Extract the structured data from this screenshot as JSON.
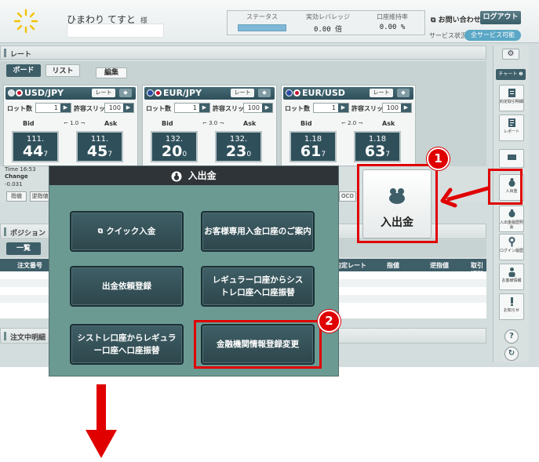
{
  "header": {
    "user_name": "ひまわり てすと",
    "user_suffix": "様",
    "status_label": "ステータス",
    "leverage_label": "実効レバレッジ",
    "leverage_value": "0.00 倍",
    "margin_label": "口座維持率",
    "margin_value": "0.00 %",
    "contact_label": "お問い合わせ",
    "logout_label": "ログアウト",
    "service_label": "サービス状況",
    "service_value": "全サービス可能"
  },
  "rate": {
    "title": "レート",
    "tabs": [
      "ボード",
      "リスト"
    ],
    "edit_label": "編集",
    "pairs": [
      {
        "name": "USD/JPY",
        "lot_value": "1",
        "slip_value": "100",
        "spread": "1.0",
        "bid_main": "111.",
        "bid_big": "44",
        "bid_small": "7",
        "ask_main": "111.",
        "ask_big": "45",
        "ask_small": "7"
      },
      {
        "name": "EUR/JPY",
        "lot_value": "1",
        "slip_value": "100",
        "spread": "3.0",
        "bid_main": "132.",
        "bid_big": "20",
        "bid_small": "0",
        "ask_main": "132.",
        "ask_big": "23",
        "ask_small": "0"
      },
      {
        "name": "EUR/USD",
        "lot_value": "1",
        "slip_value": "100",
        "spread": "2.0",
        "bid_main": "1.18",
        "bid_big": "61",
        "bid_small": "7",
        "ask_main": "1.18",
        "ask_big": "63",
        "ask_small": "7"
      }
    ],
    "rate_btn": "レート",
    "lot_label": "ロット数",
    "slip_label": "許容スリップ",
    "bid_label": "Bid",
    "ask_label": "Ask",
    "time_label": "Time",
    "time_value": "16:53",
    "change_label": "Change",
    "change_value": "-0.031",
    "limit_btn": "指値",
    "stop_btn": "逆指値",
    "oco_btn": "OCO"
  },
  "position": {
    "title": "ポジション",
    "tab_all": "一覧",
    "col_order_no": "注文番号",
    "col_rate": "約定レート",
    "col_limit": "指値",
    "col_stop": "逆指値",
    "col_cert": "取引証拠金"
  },
  "orders": {
    "title": "注文中明細"
  },
  "side": {
    "chart_label": "チャート",
    "items": [
      {
        "label": "約定取引明細",
        "icon": "ledger-icon"
      },
      {
        "label": "レポート",
        "icon": "report-icon"
      },
      {
        "label": "入出金",
        "icon": "money-bag-icon"
      },
      {
        "label": "入出金履歴照会",
        "icon": "history-icon"
      },
      {
        "label": "ログイン履歴",
        "icon": "key-icon"
      },
      {
        "label": "お客様情報",
        "icon": "person-icon"
      },
      {
        "label": "お知らせ",
        "icon": "notice-icon"
      }
    ]
  },
  "modal": {
    "title": "入出金",
    "buttons": [
      "クイック入金",
      "お客様専用入金口座のご案内",
      "出金依頼登録",
      "レギュラー口座からシストレ口座へ口座振替",
      "シストレ口座からレギュラー口座へ口座振替",
      "金融機関情報登録変更"
    ]
  },
  "callout": {
    "big_button_label": "入出金",
    "badge1": "1",
    "badge2": "2"
  },
  "colors": {
    "accent_red": "#e00000",
    "modal_bg": "#6b9a93",
    "button_dark": "#2d464c"
  }
}
